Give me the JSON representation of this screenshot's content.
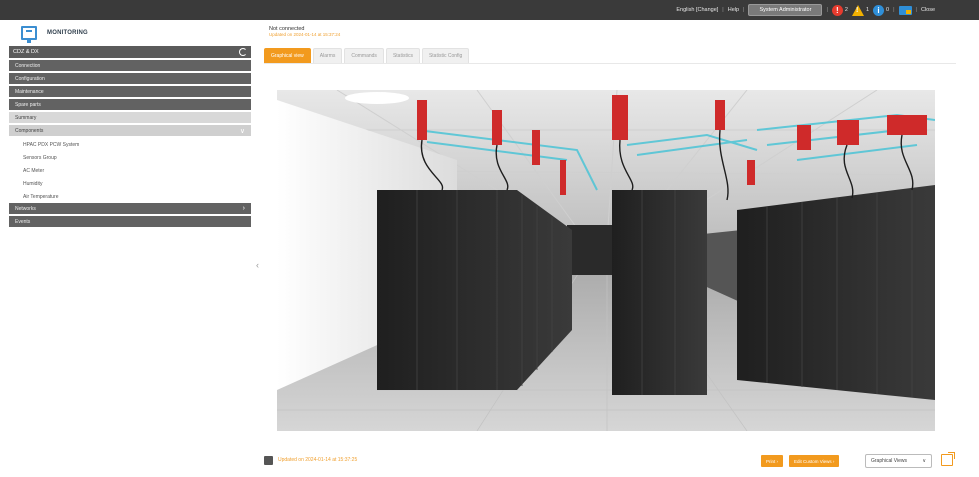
{
  "topbar": {
    "language": "English [Change]",
    "help": "Help",
    "user": "System Administrator",
    "alarm_count": "2",
    "warning_count": "1",
    "info_count": "0",
    "close": "Close",
    "sep": "|"
  },
  "brand": {
    "title": "MONITORING"
  },
  "sidebar": {
    "site": "CDZ & DX",
    "items": [
      {
        "label": "Connection"
      },
      {
        "label": "Configuration"
      },
      {
        "label": "Maintenance"
      },
      {
        "label": "Spare parts"
      },
      {
        "label": "Summary"
      },
      {
        "label": "Components"
      }
    ],
    "components": [
      {
        "label": "HPAC PDX PCW System"
      },
      {
        "label": "Sensors Group"
      },
      {
        "label": "AC Meter"
      },
      {
        "label": "Humidity"
      },
      {
        "label": "Air Temperature"
      }
    ],
    "network": "Networks",
    "events": "Events"
  },
  "main": {
    "status": "Not connected",
    "updated": "Updated on 2024-01-14 at 15:37:24",
    "tabs": [
      {
        "label": "Graphical view"
      },
      {
        "label": "Alarms"
      },
      {
        "label": "Commands"
      },
      {
        "label": "Statistics"
      },
      {
        "label": "Statistic Config"
      }
    ]
  },
  "footer": {
    "updated": "Updated on 2024-01-14 at 15:37:25",
    "print": "Print ›",
    "edit": "Edit Custom Views ›",
    "view_select": "Graphical Views",
    "chevron": "∨"
  },
  "colors": {
    "accent": "#f29a1e",
    "alarm": "#e53b2e",
    "info": "#2f8fd8"
  }
}
